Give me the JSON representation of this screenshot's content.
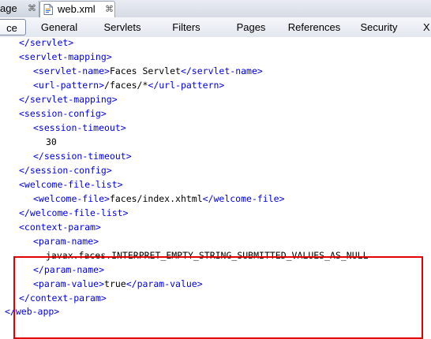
{
  "editor_tabs": [
    {
      "label": "age",
      "close": "⌘"
    },
    {
      "label": "web.xml",
      "close": "⌘"
    }
  ],
  "section_tabs": [
    "ce",
    "General",
    "Servlets",
    "Filters",
    "Pages",
    "References",
    "Security",
    "X"
  ],
  "code_lines": [
    {
      "tag1": "</servlet>",
      "text": "",
      "tag2": ""
    },
    {
      "tag1": "<servlet-mapping>",
      "text": "",
      "tag2": ""
    },
    {
      "tag1": "<servlet-name>",
      "text": "Faces Servlet",
      "tag2": "</servlet-name>"
    },
    {
      "tag1": "<url-pattern>",
      "text": "/faces/*",
      "tag2": "</url-pattern>"
    },
    {
      "tag1": "</servlet-mapping>",
      "text": "",
      "tag2": ""
    },
    {
      "tag1": "<session-config>",
      "text": "",
      "tag2": ""
    },
    {
      "tag1": "<session-timeout>",
      "text": "",
      "tag2": ""
    },
    {
      "tag1": "",
      "text": "30",
      "tag2": ""
    },
    {
      "tag1": "</session-timeout>",
      "text": "",
      "tag2": ""
    },
    {
      "tag1": "</session-config>",
      "text": "",
      "tag2": ""
    },
    {
      "tag1": "<welcome-file-list>",
      "text": "",
      "tag2": ""
    },
    {
      "tag1": "<welcome-file>",
      "text": "faces/index.xhtml",
      "tag2": "</welcome-file>"
    },
    {
      "tag1": "</welcome-file-list>",
      "text": "",
      "tag2": ""
    },
    {
      "tag1": "<context-param>",
      "text": "",
      "tag2": ""
    },
    {
      "tag1": "<param-name>",
      "text": "",
      "tag2": ""
    },
    {
      "tag1": "",
      "text": "javax.faces.INTERPRET_EMPTY_STRING_SUBMITTED_VALUES_AS_NULL",
      "tag2": ""
    },
    {
      "tag1": "</param-name>",
      "text": "",
      "tag2": ""
    },
    {
      "tag1": "<param-value>",
      "text": "true",
      "tag2": "</param-value>"
    },
    {
      "tag1": "</context-param>",
      "text": "",
      "tag2": ""
    },
    {
      "tag1": "</web-app>",
      "text": "",
      "tag2": ""
    }
  ],
  "colors": {
    "tag": "#0000e6",
    "text": "#000000",
    "highlight_border": "#e00000"
  }
}
